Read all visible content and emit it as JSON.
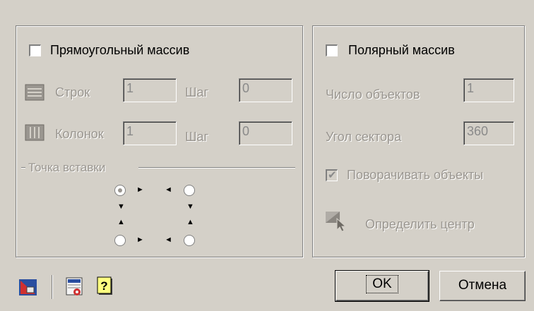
{
  "rect_array": {
    "checkbox_label": "Прямоугольный массив",
    "rows_label": "Строк",
    "rows_value": "1",
    "row_step_label": "Шаг",
    "row_step_value": "0",
    "cols_label": "Колонок",
    "cols_value": "1",
    "col_step_label": "Шаг",
    "col_step_value": "0",
    "insert_point_label": "Точка вставки",
    "rows_icon": "rows-icon",
    "cols_icon": "columns-icon"
  },
  "polar_array": {
    "checkbox_label": "Полярный массив",
    "count_label": "Число объектов",
    "count_value": "1",
    "angle_label": "Угол сектора",
    "angle_value": "360",
    "rotate_label": "Поворачивать объекты",
    "rotate_checked": true,
    "define_center_label": "Определить центр"
  },
  "footer": {
    "ok_label": "OK",
    "cancel_label": "Отмена",
    "icons": [
      "array-tool-icon",
      "gost-table-icon",
      "help-icon"
    ]
  }
}
